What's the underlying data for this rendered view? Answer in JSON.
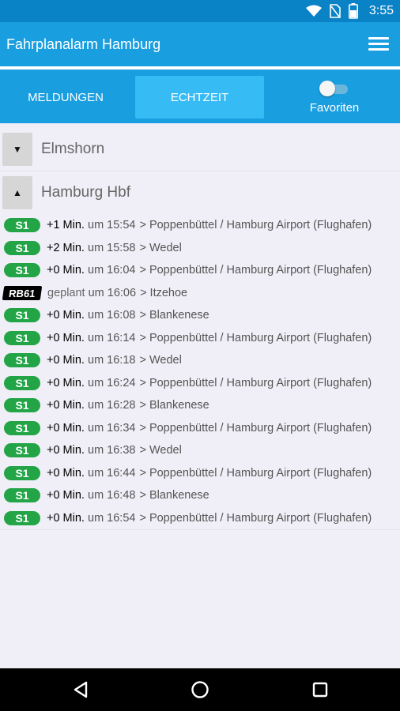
{
  "status": {
    "time": "3:55"
  },
  "appbar": {
    "title": "Fahrplanalarm Hamburg",
    "menu_icon": "hamburger-menu-icon"
  },
  "tabs": {
    "meldungen": "MELDUNGEN",
    "echtzeit": "ECHTZEIT",
    "favoriten": "Favoriten",
    "favoriten_toggle": "off",
    "active_tab": "ECHTZEIT"
  },
  "stations": [
    {
      "name": "Elmshorn",
      "toggle": "▼"
    },
    {
      "name": "Hamburg Hbf",
      "toggle": "▲"
    }
  ],
  "departures": [
    {
      "line": "S1",
      "delay": "+1 Min.",
      "um": "um",
      "time": "15:54",
      "dest": "> Poppenbüttel / Hamburg Airport (Flughafen)"
    },
    {
      "line": "S1",
      "delay": "+2 Min.",
      "um": "um",
      "time": "15:58",
      "dest": "> Wedel"
    },
    {
      "line": "S1",
      "delay": "+0 Min.",
      "um": "um",
      "time": "16:04",
      "dest": "> Poppenbüttel / Hamburg Airport (Flughafen)"
    },
    {
      "line": "RB61",
      "delay": "geplant",
      "um": "um",
      "time": "16:06",
      "dest": "> Itzehoe"
    },
    {
      "line": "S1",
      "delay": "+0 Min.",
      "um": "um",
      "time": "16:08",
      "dest": "> Blankenese"
    },
    {
      "line": "S1",
      "delay": "+0 Min.",
      "um": "um",
      "time": "16:14",
      "dest": "> Poppenbüttel / Hamburg Airport (Flughafen)"
    },
    {
      "line": "S1",
      "delay": "+0 Min.",
      "um": "um",
      "time": "16:18",
      "dest": "> Wedel"
    },
    {
      "line": "S1",
      "delay": "+0 Min.",
      "um": "um",
      "time": "16:24",
      "dest": "> Poppenbüttel / Hamburg Airport (Flughafen)"
    },
    {
      "line": "S1",
      "delay": "+0 Min.",
      "um": "um",
      "time": "16:28",
      "dest": "> Blankenese"
    },
    {
      "line": "S1",
      "delay": "+0 Min.",
      "um": "um",
      "time": "16:34",
      "dest": "> Poppenbüttel / Hamburg Airport (Flughafen)"
    },
    {
      "line": "S1",
      "delay": "+0 Min.",
      "um": "um",
      "time": "16:38",
      "dest": "> Wedel"
    },
    {
      "line": "S1",
      "delay": "+0 Min.",
      "um": "um",
      "time": "16:44",
      "dest": "> Poppenbüttel / Hamburg Airport (Flughafen)"
    },
    {
      "line": "S1",
      "delay": "+0 Min.",
      "um": "um",
      "time": "16:48",
      "dest": "> Blankenese"
    },
    {
      "line": "S1",
      "delay": "+0 Min.",
      "um": "um",
      "time": "16:54",
      "dest": "> Poppenbüttel / Hamburg Airport (Flughafen)"
    }
  ],
  "colors": {
    "primary": "#199ee0",
    "status_bar": "#0a83c6",
    "active_tab": "#37bbf5",
    "s_bahn": "#23a547",
    "regional": "#000000"
  }
}
